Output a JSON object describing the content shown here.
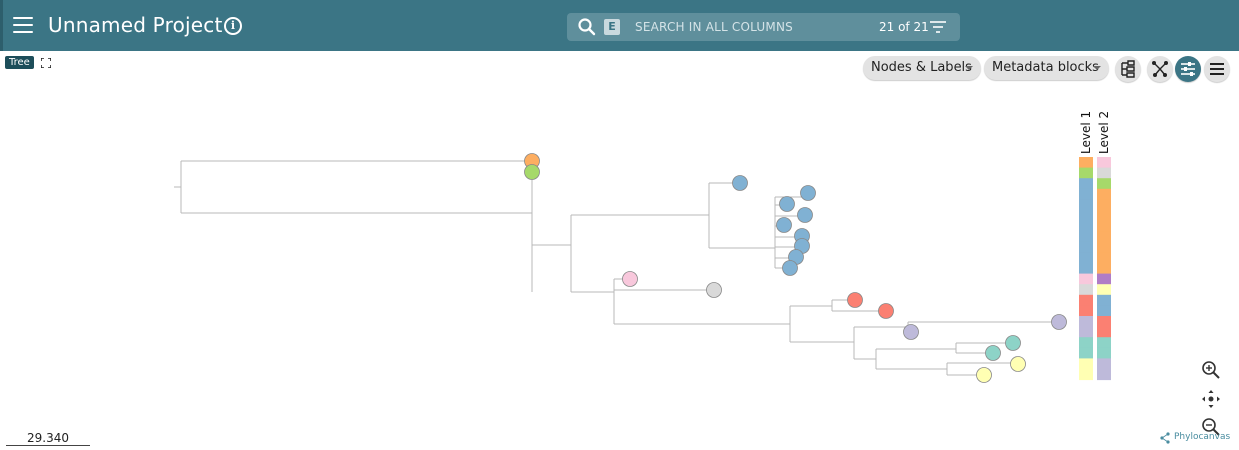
{
  "app": {
    "project_title": "Unnamed Project",
    "brand": "Phylocanvas"
  },
  "search": {
    "badge": "E",
    "placeholder": "SEARCH IN ALL COLUMNS",
    "count": "21 of 21"
  },
  "tree_panel": {
    "label": "Tree",
    "toolbar": {
      "nodes_labels": "Nodes & Labels",
      "metadata_blocks": "Metadata blocks"
    },
    "scale": "29.340",
    "metadata_columns": [
      "Level 1",
      "Level 2"
    ]
  },
  "colors": {
    "header": "#3b7585",
    "branch": "#b8b8b8"
  },
  "leaves": [
    {
      "id": "l1",
      "color": "#fdae61",
      "level1": "#fdae61",
      "level2": "#f8c8dc"
    },
    {
      "id": "l2",
      "color": "#a6d96a",
      "level1": "#a6d96a",
      "level2": "#d9d9d9"
    },
    {
      "id": "l3",
      "color": "#80b1d3",
      "level1": "#80b1d3",
      "level2": "#a6d96a"
    },
    {
      "id": "l4",
      "color": "#80b1d3",
      "level1": "#80b1d3",
      "level2": "#fdae61"
    },
    {
      "id": "l5",
      "color": "#80b1d3",
      "level1": "#80b1d3",
      "level2": "#fdae61"
    },
    {
      "id": "l6",
      "color": "#80b1d3",
      "level1": "#80b1d3",
      "level2": "#fdae61"
    },
    {
      "id": "l7",
      "color": "#80b1d3",
      "level1": "#80b1d3",
      "level2": "#fdae61"
    },
    {
      "id": "l8",
      "color": "#80b1d3",
      "level1": "#80b1d3",
      "level2": "#fdae61"
    },
    {
      "id": "l9",
      "color": "#80b1d3",
      "level1": "#80b1d3",
      "level2": "#fdae61"
    },
    {
      "id": "l10",
      "color": "#80b1d3",
      "level1": "#80b1d3",
      "level2": "#fdae61"
    },
    {
      "id": "l11",
      "color": "#80b1d3",
      "level1": "#80b1d3",
      "level2": "#fdae61"
    },
    {
      "id": "l12",
      "color": "#f8c8dc",
      "level1": "#f8c8dc",
      "level2": "#b07cc6"
    },
    {
      "id": "l13",
      "color": "#d9d9d9",
      "level1": "#d9d9d9",
      "level2": "#ffffb3"
    },
    {
      "id": "l14",
      "color": "#fb8072",
      "level1": "#fb8072",
      "level2": "#80b1d3"
    },
    {
      "id": "l15",
      "color": "#fb8072",
      "level1": "#fb8072",
      "level2": "#80b1d3"
    },
    {
      "id": "l16",
      "color": "#bebada",
      "level1": "#bebada",
      "level2": "#fb8072"
    },
    {
      "id": "l17",
      "color": "#bebada",
      "level1": "#bebada",
      "level2": "#fb8072"
    },
    {
      "id": "l18",
      "color": "#8dd3c7",
      "level1": "#8dd3c7",
      "level2": "#8dd3c7"
    },
    {
      "id": "l19",
      "color": "#8dd3c7",
      "level1": "#8dd3c7",
      "level2": "#8dd3c7"
    },
    {
      "id": "l20",
      "color": "#ffffb3",
      "level1": "#ffffb3",
      "level2": "#bebada"
    },
    {
      "id": "l21",
      "color": "#ffffb3",
      "level1": "#ffffb3",
      "level2": "#bebada"
    }
  ]
}
